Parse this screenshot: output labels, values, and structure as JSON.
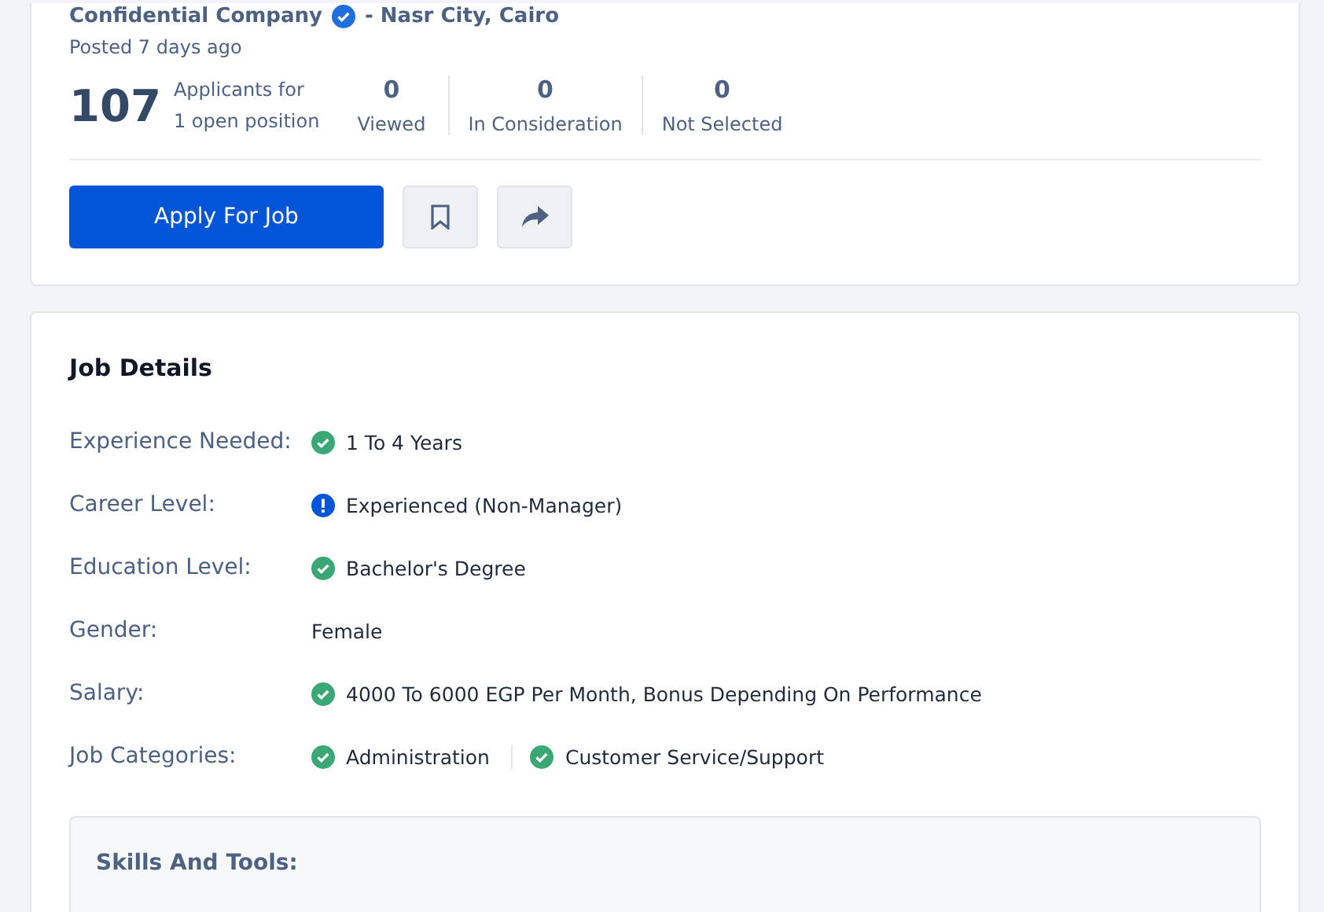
{
  "job_header": {
    "company": "Confidential Company",
    "verified": true,
    "location": "- Nasr City, Cairo",
    "posted": "Posted 7 days ago"
  },
  "applicants": {
    "count": "107",
    "label_line1": "Applicants for",
    "label_line2": "1 open position"
  },
  "stats": [
    {
      "value": "0",
      "label": "Viewed"
    },
    {
      "value": "0",
      "label": "In Consideration"
    },
    {
      "value": "0",
      "label": "Not Selected"
    }
  ],
  "actions": {
    "apply_button": "Apply For Job"
  },
  "job_details": {
    "title": "Job Details",
    "rows": [
      {
        "label": "Experience Needed:",
        "values": [
          {
            "text": "1 To 4 Years",
            "kind": "check"
          }
        ]
      },
      {
        "label": "Career Level:",
        "values": [
          {
            "text": "Experienced (Non-Manager)",
            "kind": "info"
          }
        ]
      },
      {
        "label": "Education Level:",
        "values": [
          {
            "text": "Bachelor's Degree",
            "kind": "check"
          }
        ]
      },
      {
        "label": "Gender:",
        "values": [
          {
            "text": "Female",
            "kind": "plain"
          }
        ]
      },
      {
        "label": "Salary:",
        "values": [
          {
            "text": "4000 To 6000 EGP Per Month, Bonus Depending On Performance",
            "kind": "check"
          }
        ]
      },
      {
        "label": "Job Categories:",
        "values": [
          {
            "text": "Administration",
            "kind": "check"
          },
          {
            "text": "Customer Service/Support",
            "kind": "check"
          }
        ]
      }
    ],
    "skills_title": "Skills And Tools:"
  }
}
